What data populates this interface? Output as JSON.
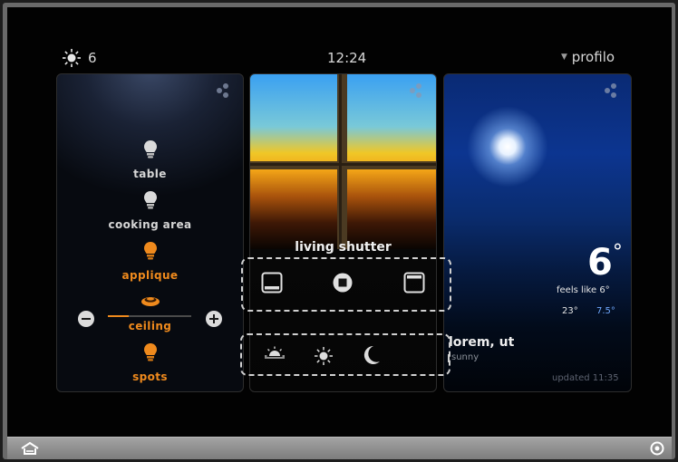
{
  "header": {
    "weather_icon": "sun-icon",
    "outdoor_value": "6",
    "time": "12:24",
    "profile_label": "profilo",
    "profile_caret": "▼"
  },
  "lights": {
    "dots_icon": "options-dots-icon",
    "items": [
      {
        "label": "table",
        "state": "off",
        "color": "#d0d0d0"
      },
      {
        "label": "cooking area",
        "state": "off",
        "color": "#d0d0d0"
      },
      {
        "label": "applique",
        "state": "on",
        "color": "#ef8a1d"
      },
      {
        "label": "ceiling",
        "state": "on",
        "color": "#ef8a1d"
      },
      {
        "label": "spots",
        "state": "on",
        "color": "#ef8a1d"
      }
    ],
    "dimmer_level": 0.25
  },
  "shutter": {
    "title": "living shutter",
    "controls": [
      "shutter-down-icon",
      "shutter-stop-icon",
      "shutter-up-icon"
    ],
    "scenes": [
      "sunrise-icon",
      "sun-icon",
      "moon-icon"
    ]
  },
  "weather": {
    "temperature": "6",
    "degree": "°",
    "feels_like": "feels like 6°",
    "max": "23°",
    "min": "7.5°",
    "location": "lorem, ut",
    "condition": "sunny",
    "updated": "updated 11:35"
  },
  "footer": {
    "home_icon": "home-icon",
    "settings_icon": "settings-icon"
  },
  "colors": {
    "accent": "#ef8a1d",
    "min_temp": "#6fa8ff"
  }
}
